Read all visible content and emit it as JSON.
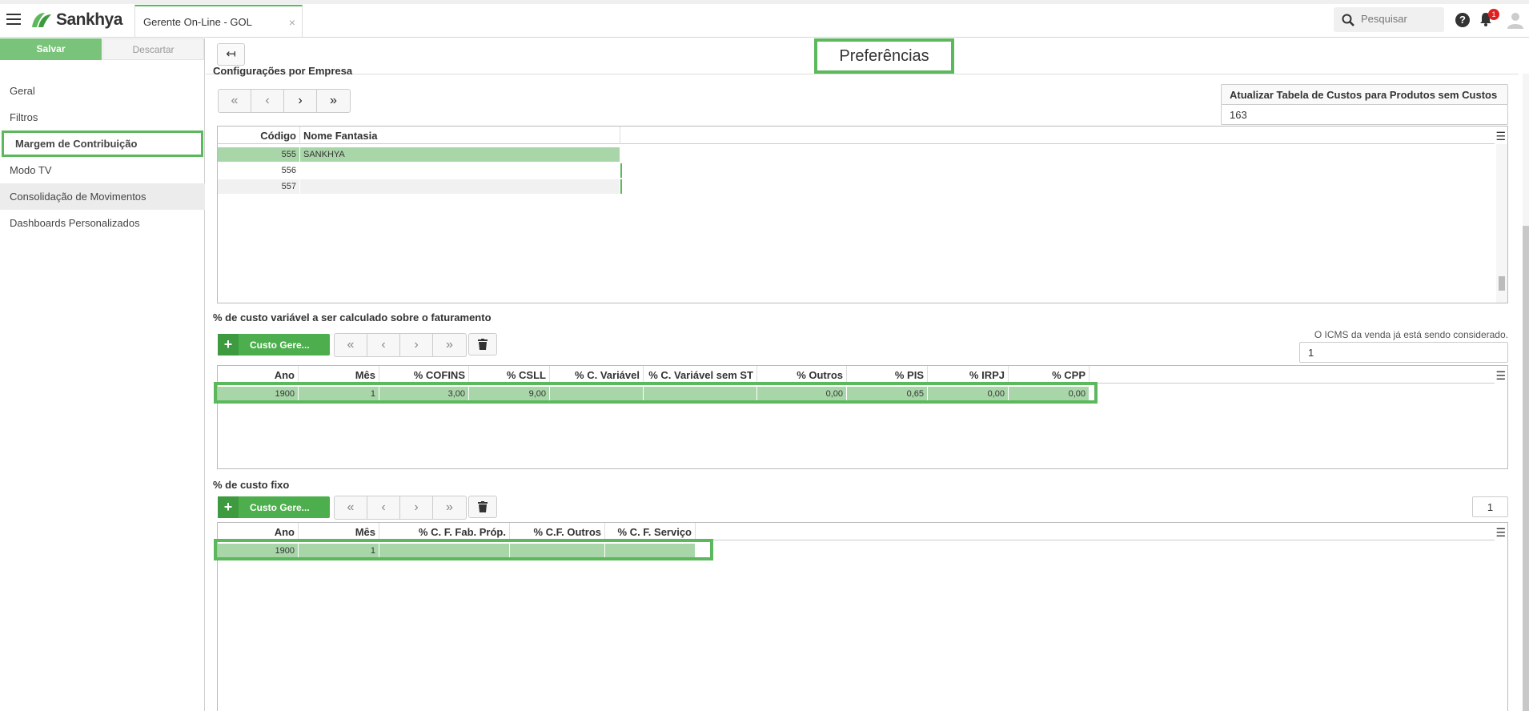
{
  "app": {
    "brand": "Sankhya",
    "tab_title": "Gerente On-Line - GOL",
    "tab_close": "×",
    "search_placeholder": "Pesquisar",
    "help": "?",
    "notif_count": "1"
  },
  "sidebar": {
    "save": "Salvar",
    "discard": "Descartar",
    "items": [
      {
        "label": "Geral"
      },
      {
        "label": "Filtros"
      },
      {
        "label": "Margem de Contribuição"
      },
      {
        "label": "Modo TV"
      },
      {
        "label": "Consolidação de Movimentos"
      },
      {
        "label": "Dashboards Personalizados"
      }
    ]
  },
  "page": {
    "title": "Preferências",
    "back": "↤"
  },
  "empresa": {
    "title": "Configurações por Empresa",
    "update_label": "Atualizar Tabela de Custos para Produtos sem Custos",
    "update_value": "163",
    "headers": [
      "Código",
      "Nome Fantasia"
    ],
    "rows": [
      {
        "codigo": "555",
        "nome": "SANKHYA"
      },
      {
        "codigo": "556",
        "nome": ""
      },
      {
        "codigo": "557",
        "nome": ""
      }
    ]
  },
  "variavel": {
    "title": "% de custo variável a ser calculado sobre o faturamento",
    "button": "Custo Gere...",
    "icms_label": "O ICMS da venda já está sendo considerado.",
    "icms_value": "1",
    "headers": [
      "Ano",
      "Mês",
      "% COFINS",
      "% CSLL",
      "% C. Variável",
      "% C. Variável sem ST",
      "% Outros",
      "% PIS",
      "% IRPJ",
      "% CPP"
    ],
    "row": [
      "1900",
      "1",
      "3,00",
      "9,00",
      "",
      "",
      "0,00",
      "0,65",
      "0,00",
      "0,00"
    ]
  },
  "fixo": {
    "title": "% de custo fixo",
    "button": "Custo Gere...",
    "value": "1",
    "headers": [
      "Ano",
      "Mês",
      "% C. F. Fab. Próp.",
      "% C.F. Outros",
      "% C. F. Serviço"
    ],
    "row": [
      "1900",
      "1",
      "",
      "",
      ""
    ]
  },
  "colors": {
    "accent": "#5cb85c",
    "selected_row": "#a9d6a9",
    "button_green": "#4cae4c"
  }
}
